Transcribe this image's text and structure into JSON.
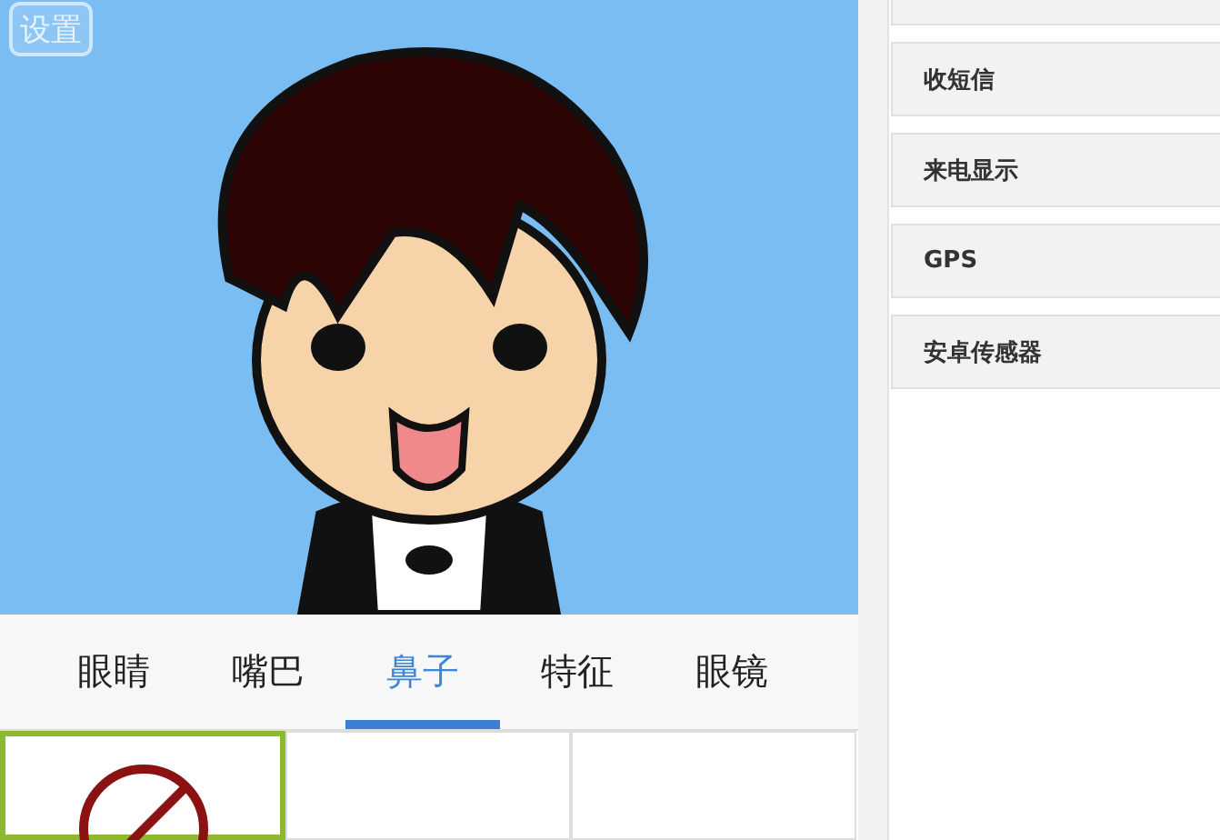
{
  "avatar": {
    "settings_button": "设置"
  },
  "tabs": [
    {
      "label": "眼睛",
      "selected": false
    },
    {
      "label": "嘴巴",
      "selected": false
    },
    {
      "label": "鼻子",
      "selected": true
    },
    {
      "label": "特征",
      "selected": false
    },
    {
      "label": "眼镜",
      "selected": false
    }
  ],
  "options": [
    {
      "kind": "none",
      "selected": true
    },
    {
      "kind": "blank",
      "selected": false
    },
    {
      "kind": "blank",
      "selected": false
    }
  ],
  "sidebar": {
    "items": [
      {
        "label": "收短信"
      },
      {
        "label": "来电显示"
      },
      {
        "label": "GPS"
      },
      {
        "label": "安卓传感器"
      }
    ]
  }
}
